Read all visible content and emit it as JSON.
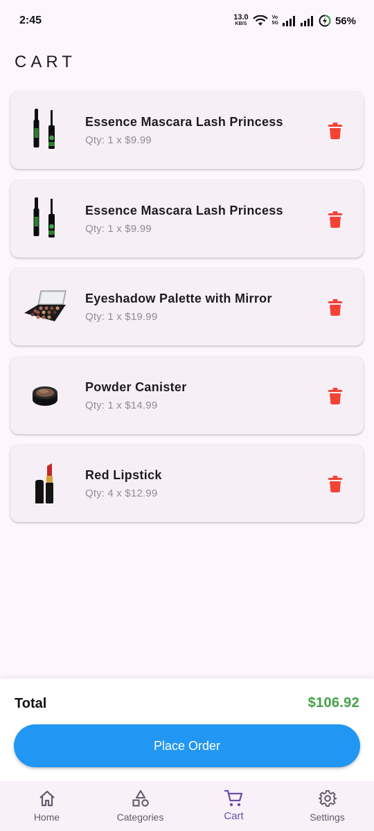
{
  "status_bar": {
    "time": "2:45",
    "net_speed_value": "13.0",
    "net_speed_unit": "KB/S",
    "volte_top": "Vo",
    "volte_bottom": "5G",
    "battery_percent": "56%"
  },
  "page": {
    "title": "CART"
  },
  "cart": {
    "items": [
      {
        "name": "Essence Mascara Lash Princess",
        "qty_label": "Qty:",
        "qty_text": "1 x $9.99",
        "thumb_icon": "mascara-icon"
      },
      {
        "name": "Essence Mascara Lash Princess",
        "qty_label": "Qty:",
        "qty_text": "1 x $9.99",
        "thumb_icon": "mascara-icon"
      },
      {
        "name": "Eyeshadow Palette with Mirror",
        "qty_label": "Qty:",
        "qty_text": "1 x $19.99",
        "thumb_icon": "eyeshadow-palette-icon"
      },
      {
        "name": "Powder Canister",
        "qty_label": "Qty:",
        "qty_text": "1 x $14.99",
        "thumb_icon": "powder-canister-icon"
      },
      {
        "name": "Red Lipstick",
        "qty_label": "Qty:",
        "qty_text": "4 x $12.99",
        "thumb_icon": "lipstick-icon"
      }
    ],
    "delete_icon": "trash-icon"
  },
  "summary": {
    "total_label": "Total",
    "total_value": "$106.92",
    "place_order_label": "Place Order"
  },
  "nav": {
    "items": [
      {
        "label": "Home",
        "icon": "home-icon",
        "active": false
      },
      {
        "label": "Categories",
        "icon": "categories-icon",
        "active": false
      },
      {
        "label": "Cart",
        "icon": "cart-icon",
        "active": true
      },
      {
        "label": "Settings",
        "icon": "gear-icon",
        "active": false
      }
    ]
  },
  "colors": {
    "accent": "#2196f3",
    "total_green": "#43a047",
    "delete_red": "#f44336",
    "nav_active": "#6a4fa8",
    "background": "#fdf7fd"
  }
}
